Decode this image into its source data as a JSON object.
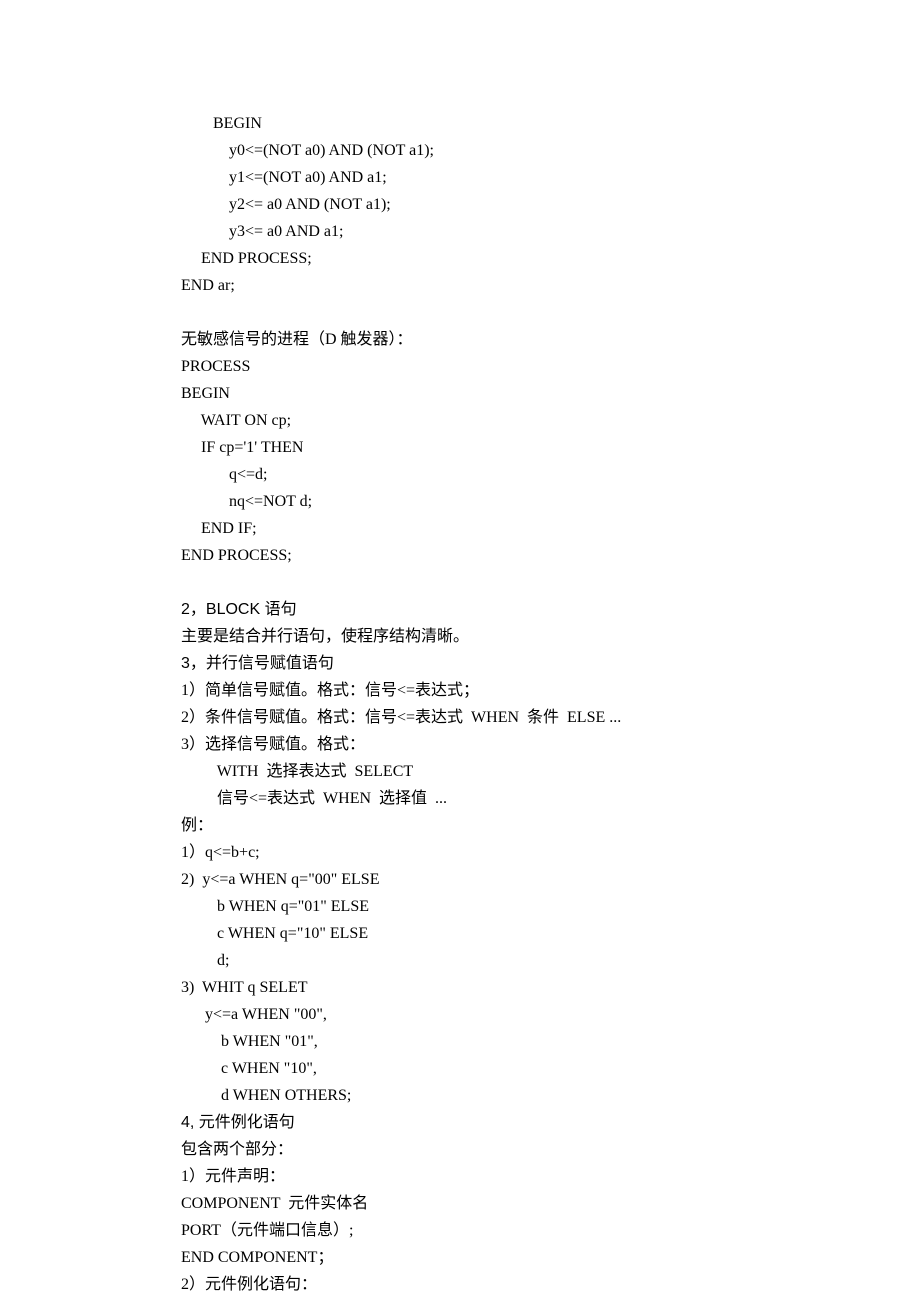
{
  "code1": [
    "        BEGIN",
    "            y0<=(NOT a0) AND (NOT a1);",
    "            y1<=(NOT a0) AND a1;",
    "            y2<= a0 AND (NOT a1);",
    "            y3<= a0 AND a1;",
    "     END PROCESS;",
    "END ar;"
  ],
  "dff_title": "无敏感信号的进程（D 触发器）：",
  "code2": [
    "PROCESS",
    "BEGIN",
    "     WAIT ON cp;",
    "     IF cp='1' THEN",
    "            q<=d;",
    "            nq<=NOT d;",
    "     END IF;",
    "END PROCESS;"
  ],
  "sec2_title": "2，BLOCK 语句",
  "sec2_body": [
    "主要是结合并行语句，使程序结构清晰。"
  ],
  "sec3_title": "3，并行信号赋值语句",
  "sec3_body": [
    "1）简单信号赋值。格式：信号<=表达式；",
    "2）条件信号赋值。格式：信号<=表达式  WHEN  条件  ELSE ...",
    "3）选择信号赋值。格式：",
    "         WITH  选择表达式  SELECT",
    "         信号<=表达式  WHEN  选择值  ...",
    "例：",
    "1）q<=b+c;",
    "2)  y<=a WHEN q=\"00\" ELSE",
    "         b WHEN q=\"01\" ELSE",
    "         c WHEN q=\"10\" ELSE",
    "         d;",
    "3)  WHIT q SELET",
    "      y<=a WHEN \"00\",",
    "          b WHEN \"01\",",
    "          c WHEN \"10\",",
    "          d WHEN OTHERS;"
  ],
  "sec4_title": "4, 元件例化语句",
  "sec4_body": [
    "包含两个部分：",
    "1）元件声明：",
    "COMPONENT  元件实体名",
    "PORT（元件端口信息）;",
    "END COMPONENT；",
    "2）元件例化语句："
  ]
}
